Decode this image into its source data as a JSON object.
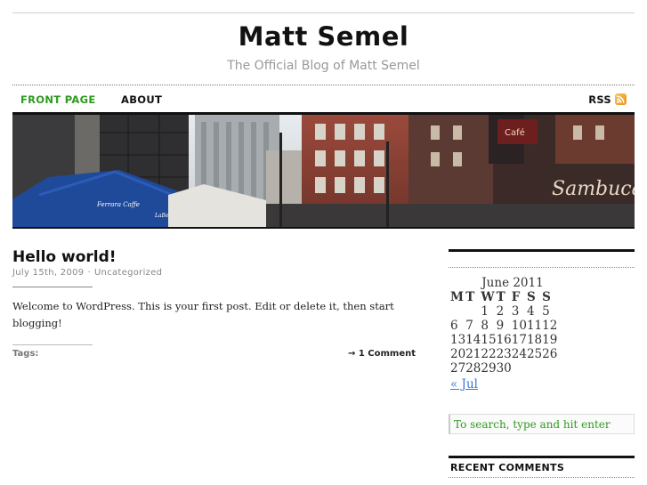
{
  "header": {
    "site_title": "Matt Semel",
    "description": "The Official Blog of Matt Semel"
  },
  "nav": {
    "items": [
      {
        "label": "FRONT PAGE"
      },
      {
        "label": "ABOUT"
      }
    ],
    "rss_label": "RSS",
    "active_color": "#2e9a1f"
  },
  "banner": {
    "icon": "street-photo",
    "signs": [
      "Ferrara Caffe",
      "LaBella Ferrara Caffe",
      "Sambuca"
    ]
  },
  "post": {
    "title": "Hello world!",
    "date": "July 15th, 2009",
    "separator": "·",
    "category": "Uncategorized",
    "body": "Welcome to WordPress. This is your first post. Edit or delete it, then start blogging!",
    "tags_label": "Tags:",
    "comments_link": "→ 1 Comment"
  },
  "sidebar": {
    "calendar": {
      "caption": "June 2011",
      "weekdays": [
        "M",
        "T",
        "W",
        "T",
        "F",
        "S",
        "S"
      ],
      "weeks": [
        [
          "",
          "",
          "1",
          "2",
          "3",
          "4",
          "5"
        ],
        [
          "6",
          "7",
          "8",
          "9",
          "10",
          "11",
          "12"
        ],
        [
          "13",
          "14",
          "15",
          "16",
          "17",
          "18",
          "19"
        ],
        [
          "20",
          "21",
          "22",
          "23",
          "24",
          "25",
          "26"
        ],
        [
          "27",
          "28",
          "29",
          "30",
          "",
          "",
          ""
        ]
      ],
      "prev_link": "« Jul"
    },
    "search_placeholder": "To search, type and hit enter",
    "recent_comments_title": "RECENT COMMENTS"
  }
}
